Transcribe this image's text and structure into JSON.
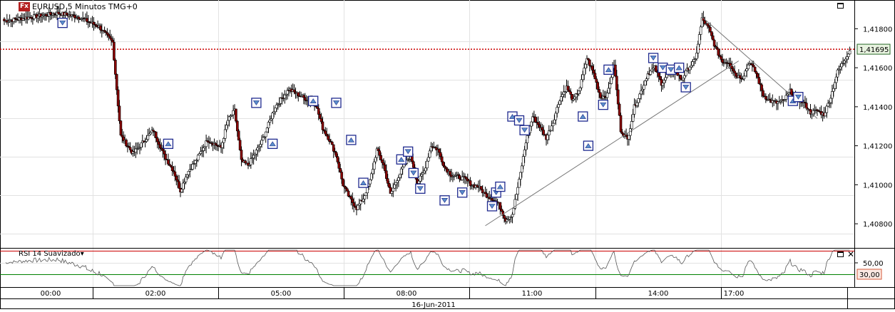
{
  "header": {
    "badge": "Fx",
    "title": "EURUSD 5 Minutos TMG+0"
  },
  "price_scale": {
    "ticks": [
      "1,41800",
      "1,41600",
      "1,41400",
      "1,41200",
      "1,41000",
      "1,40800"
    ],
    "current_price_label": "1,41695"
  },
  "rsi": {
    "title": "RSI 14 Suavizado",
    "dropdown_glyph": "▾",
    "ticks": [
      "50,00"
    ],
    "level_label": "30,00"
  },
  "time_axis": {
    "ticks": [
      "00:00",
      "02:00",
      "05:00",
      "08:00",
      "11:00",
      "14:00",
      "17:00"
    ],
    "date": "16-Jun-2011"
  },
  "colors": {
    "bull": "#ffffff",
    "bear": "#8b0000",
    "wick": "#000000",
    "marker": "#1f2a8f",
    "price_line": "#cc0000",
    "rsi_line": "#555555",
    "rsi_high": "#cc0000",
    "rsi_low": "#008000",
    "label_bg_price": "#e8f3e0",
    "label_bg_rsi": "#fbe9e3"
  },
  "chart_data": {
    "type": "candlestick",
    "title": "EURUSD 5 Minutos TMG+0",
    "x_date": "16-Jun-2011",
    "x_ticks": [
      "00:00",
      "02:00",
      "05:00",
      "08:00",
      "11:00",
      "14:00",
      "17:00"
    ],
    "ylim": [
      1.4068,
      1.4194
    ],
    "current_price": 1.41695,
    "anchors": [
      [
        0,
        1.4184
      ],
      [
        20,
        1.4186
      ],
      [
        40,
        1.4188
      ],
      [
        55,
        1.4186
      ],
      [
        70,
        1.4181
      ],
      [
        80,
        1.4173
      ],
      [
        86,
        1.4125
      ],
      [
        95,
        1.4116
      ],
      [
        110,
        1.4128
      ],
      [
        118,
        1.4115
      ],
      [
        125,
        1.4107
      ],
      [
        130,
        1.4097
      ],
      [
        135,
        1.4106
      ],
      [
        142,
        1.4113
      ],
      [
        150,
        1.4123
      ],
      [
        160,
        1.4119
      ],
      [
        165,
        1.4133
      ],
      [
        170,
        1.4138
      ],
      [
        175,
        1.4112
      ],
      [
        180,
        1.411
      ],
      [
        190,
        1.4122
      ],
      [
        200,
        1.414
      ],
      [
        210,
        1.4149
      ],
      [
        220,
        1.4145
      ],
      [
        230,
        1.4141
      ],
      [
        235,
        1.4129
      ],
      [
        240,
        1.4123
      ],
      [
        245,
        1.4115
      ],
      [
        250,
        1.41
      ],
      [
        255,
        1.4093
      ],
      [
        260,
        1.4088
      ],
      [
        265,
        1.4093
      ],
      [
        270,
        1.4102
      ],
      [
        275,
        1.4118
      ],
      [
        280,
        1.411
      ],
      [
        285,
        1.4095
      ],
      [
        290,
        1.4103
      ],
      [
        295,
        1.411
      ],
      [
        300,
        1.4115
      ],
      [
        305,
        1.4101
      ],
      [
        310,
        1.4107
      ],
      [
        315,
        1.412
      ],
      [
        320,
        1.4118
      ],
      [
        325,
        1.4109
      ],
      [
        330,
        1.4105
      ],
      [
        340,
        1.4103
      ],
      [
        345,
        1.41
      ],
      [
        350,
        1.4099
      ],
      [
        355,
        1.4095
      ],
      [
        360,
        1.4093
      ],
      [
        365,
        1.409
      ],
      [
        370,
        1.4082
      ],
      [
        375,
        1.4085
      ],
      [
        380,
        1.4102
      ],
      [
        385,
        1.4122
      ],
      [
        390,
        1.4135
      ],
      [
        395,
        1.413
      ],
      [
        400,
        1.4124
      ],
      [
        405,
        1.4132
      ],
      [
        410,
        1.4144
      ],
      [
        415,
        1.415
      ],
      [
        420,
        1.4143
      ],
      [
        425,
        1.415
      ],
      [
        430,
        1.4165
      ],
      [
        435,
        1.4157
      ],
      [
        440,
        1.4145
      ],
      [
        445,
        1.4146
      ],
      [
        450,
        1.4162
      ],
      [
        455,
        1.4128
      ],
      [
        460,
        1.4123
      ],
      [
        465,
        1.414
      ],
      [
        470,
        1.4148
      ],
      [
        475,
        1.4157
      ],
      [
        480,
        1.416
      ],
      [
        485,
        1.4152
      ],
      [
        490,
        1.4157
      ],
      [
        495,
        1.4158
      ],
      [
        500,
        1.4154
      ],
      [
        505,
        1.416
      ],
      [
        510,
        1.4164
      ],
      [
        515,
        1.4185
      ],
      [
        520,
        1.418
      ],
      [
        525,
        1.417
      ],
      [
        530,
        1.4163
      ],
      [
        535,
        1.4163
      ],
      [
        540,
        1.4156
      ],
      [
        545,
        1.4155
      ],
      [
        550,
        1.4163
      ],
      [
        555,
        1.4157
      ],
      [
        560,
        1.4146
      ],
      [
        565,
        1.4143
      ],
      [
        570,
        1.4142
      ],
      [
        575,
        1.4143
      ],
      [
        580,
        1.4148
      ],
      [
        585,
        1.4144
      ],
      [
        590,
        1.4142
      ],
      [
        595,
        1.4137
      ],
      [
        600,
        1.4138
      ],
      [
        605,
        1.4136
      ],
      [
        610,
        1.4145
      ],
      [
        615,
        1.4158
      ],
      [
        620,
        1.4164
      ],
      [
        624,
        1.4169
      ]
    ],
    "trendlines": [
      {
        "from": [
          355,
          1.4079
        ],
        "to": [
          542,
          1.41635
        ]
      },
      {
        "from": [
          515,
          1.4186
        ],
        "to": [
          600,
          1.4134
        ]
      }
    ],
    "markers": [
      [
        43,
        1.4183,
        "down"
      ],
      [
        121,
        1.4121,
        "up"
      ],
      [
        186,
        1.4142,
        "down"
      ],
      [
        198,
        1.4121,
        "up"
      ],
      [
        228,
        1.4143,
        "up"
      ],
      [
        245,
        1.4142,
        "down"
      ],
      [
        256,
        1.4123,
        "up"
      ],
      [
        265,
        1.4101,
        "up"
      ],
      [
        293,
        1.4113,
        "up"
      ],
      [
        298,
        1.4117,
        "down"
      ],
      [
        302,
        1.4106,
        "down"
      ],
      [
        307,
        1.4098,
        "down"
      ],
      [
        325,
        1.4092,
        "down"
      ],
      [
        338,
        1.4096,
        "down"
      ],
      [
        360,
        1.4089,
        "down"
      ],
      [
        363,
        1.4096,
        "down"
      ],
      [
        366,
        1.4099,
        "up"
      ],
      [
        375,
        1.4135,
        "up"
      ],
      [
        380,
        1.4133,
        "down"
      ],
      [
        384,
        1.4128,
        "down"
      ],
      [
        427,
        1.4135,
        "up"
      ],
      [
        431,
        1.412,
        "up"
      ],
      [
        442,
        1.4141,
        "down"
      ],
      [
        446,
        1.4159,
        "up"
      ],
      [
        479,
        1.4165,
        "down"
      ],
      [
        486,
        1.416,
        "down"
      ],
      [
        492,
        1.4159,
        "down"
      ],
      [
        498,
        1.416,
        "up"
      ],
      [
        503,
        1.415,
        "down"
      ],
      [
        582,
        1.4143,
        "up"
      ],
      [
        586,
        1.4145,
        "down"
      ]
    ]
  }
}
